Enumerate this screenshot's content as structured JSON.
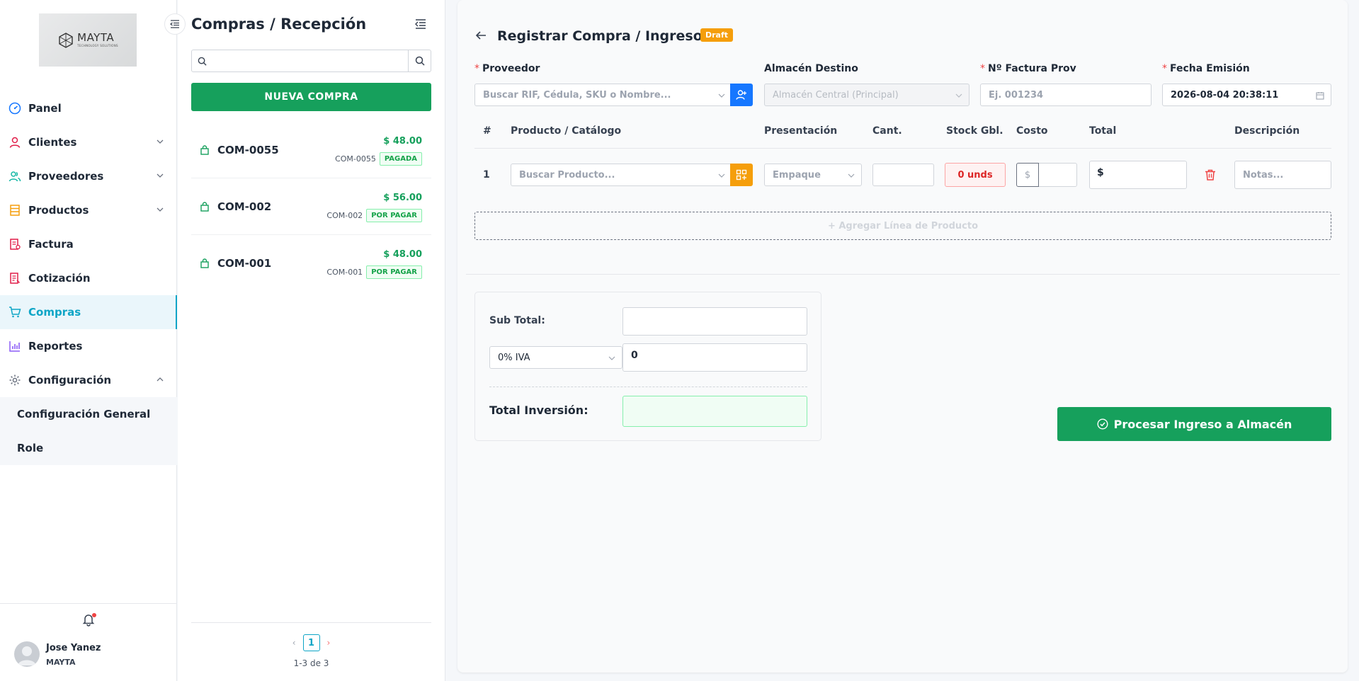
{
  "sidebar": {
    "logo": {
      "name": "MAYTA",
      "sub": "TECHNOLOGY SOLUTIONS"
    },
    "items": [
      {
        "label": "Panel",
        "icon": "dashboard-icon"
      },
      {
        "label": "Clientes",
        "icon": "user-icon"
      },
      {
        "label": "Proveedores",
        "icon": "users-icon"
      },
      {
        "label": "Productos",
        "icon": "box-icon"
      },
      {
        "label": "Factura",
        "icon": "invoice-icon"
      },
      {
        "label": "Cotización",
        "icon": "quote-icon"
      },
      {
        "label": "Compras",
        "icon": "cart-icon"
      },
      {
        "label": "Reportes",
        "icon": "chart-icon"
      },
      {
        "label": "Configuración",
        "icon": "gear-icon"
      }
    ],
    "subitems": [
      "Configuración General",
      "Role"
    ],
    "user": {
      "name": "Jose Yanez",
      "org": "MAYTA"
    }
  },
  "list": {
    "title": "Compras / Recepción",
    "search_placeholder": "",
    "new_button": "NUEVA COMPRA",
    "items": [
      {
        "code": "COM-0055",
        "amount": "$ 48.00",
        "sub": "COM-0055",
        "status": "PAGADA"
      },
      {
        "code": "COM-002",
        "amount": "$ 56.00",
        "sub": "COM-002",
        "status": "POR PAGAR"
      },
      {
        "code": "COM-001",
        "amount": "$ 48.00",
        "sub": "COM-001",
        "status": "POR PAGAR"
      }
    ],
    "page": "1",
    "range": "1-3 de 3"
  },
  "form": {
    "title": "Registrar Compra / Ingreso",
    "badge": "Draft",
    "fields": {
      "proveedor": {
        "label": "Proveedor",
        "placeholder": "Buscar RIF, Cédula, SKU o Nombre..."
      },
      "almacen": {
        "label": "Almacén Destino",
        "value": "Almacén Central (Principal)"
      },
      "factura": {
        "label": "Nº Factura Prov",
        "placeholder": "Ej. 001234"
      },
      "fecha": {
        "label": "Fecha Emisión",
        "value": "2026-08-04 20:38:11"
      }
    },
    "columns": [
      "#",
      "Producto / Catálogo",
      "Presentación",
      "Cant.",
      "Stock Gbl.",
      "Costo",
      "Total",
      "Descripción"
    ],
    "row": {
      "num": "1",
      "producto_placeholder": "Buscar Producto...",
      "presentacion_placeholder": "Empaque",
      "stock": "0 unds",
      "cost_prefix": "$",
      "total": "$",
      "desc_placeholder": "Notas..."
    },
    "add_line": "+ Agregar Línea de Producto",
    "totals": {
      "subtotal_label": "Sub Total:",
      "iva_option": "0% IVA",
      "iva_value": "0",
      "grand_label": "Total Inversión:"
    },
    "process_button": "Procesar Ingreso a Almacén"
  },
  "colors": {
    "primary_green": "#16a05c",
    "accent_cyan": "#0ea5c6",
    "draft_orange": "#f59e0b",
    "blue": "#1677ff"
  }
}
